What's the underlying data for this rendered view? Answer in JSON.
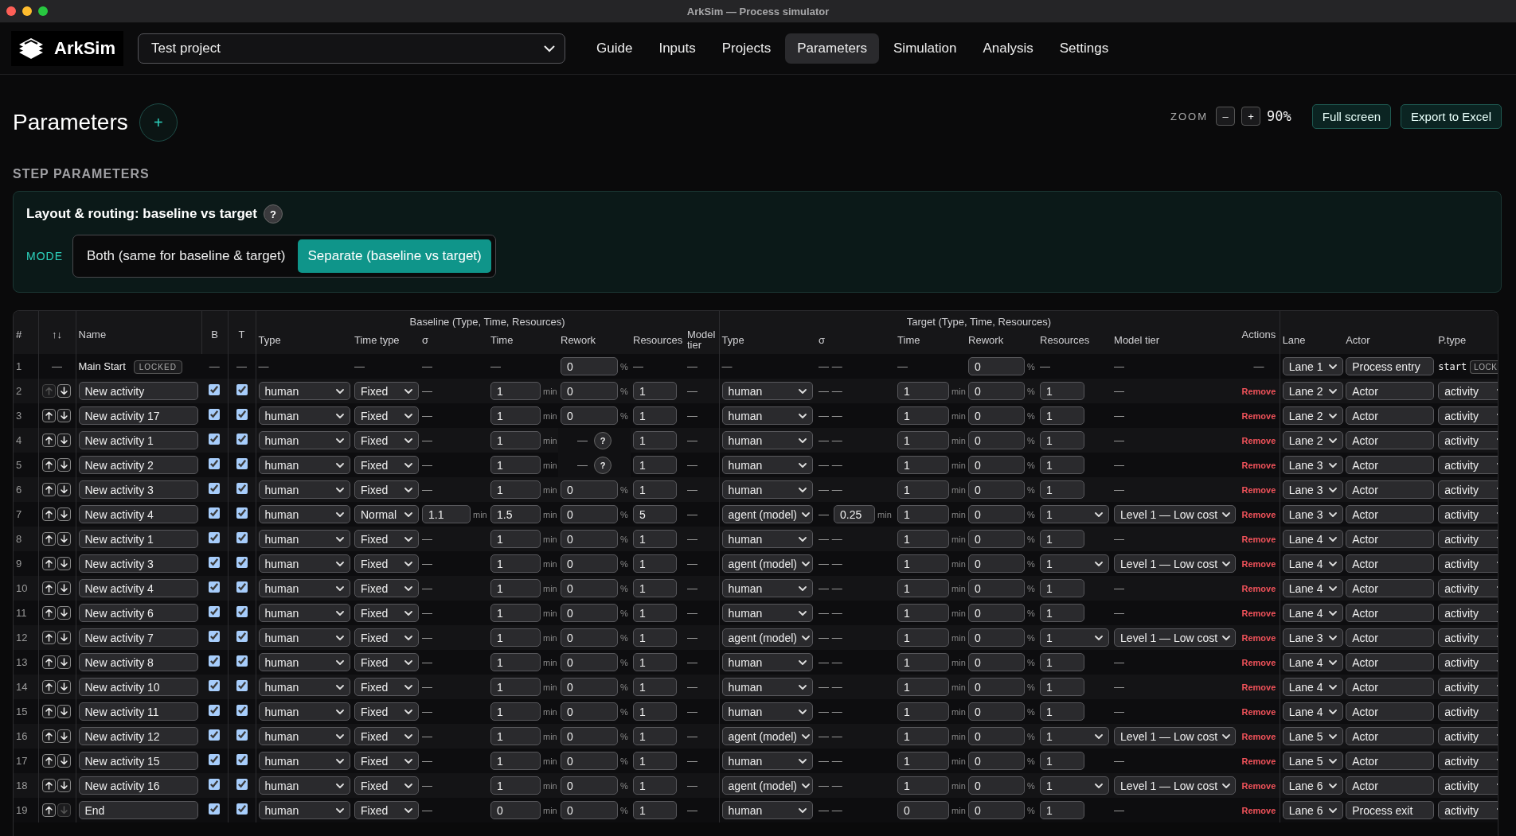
{
  "window": {
    "title": "ArkSim — Process simulator"
  },
  "header": {
    "brand": "ArkSim",
    "project": "Test project",
    "nav": [
      {
        "label": "Guide",
        "selected": false
      },
      {
        "label": "Inputs",
        "selected": false
      },
      {
        "label": "Projects",
        "selected": false
      },
      {
        "label": "Parameters",
        "selected": true
      },
      {
        "label": "Simulation",
        "selected": false
      },
      {
        "label": "Analysis",
        "selected": false
      },
      {
        "label": "Settings",
        "selected": false
      }
    ]
  },
  "page": {
    "title": "Parameters",
    "add": "+",
    "zoom_label": "ZOOM",
    "zoom_out": "–",
    "zoom_in": "+",
    "zoom_value": "90%",
    "buttons": [
      "Full screen",
      "Export to Excel"
    ]
  },
  "section": "STEP PARAMETERS",
  "card": {
    "title": "Layout & routing: baseline vs target",
    "help": "?",
    "mode_label": "MODE",
    "options": [
      {
        "label": "Both (same for baseline & target)",
        "selected": false
      },
      {
        "label": "Separate (baseline vs target)",
        "selected": true
      }
    ]
  },
  "table": {
    "columns_left": [
      "#",
      "↑↓",
      "Name",
      "B",
      "T"
    ],
    "baseline": {
      "title": "Baseline (Type, Time, Resources)",
      "columns": [
        "Type",
        "Time type",
        "σ",
        "Time",
        "Rework",
        "Resources",
        "Model tier"
      ]
    },
    "target": {
      "title": "Target (Type, Time, Resources)",
      "columns": [
        "Type",
        "σ",
        "Time",
        "Rework",
        "Resources",
        "Model tier"
      ]
    },
    "actions": "Actions",
    "columns_right": [
      "Lane",
      "Actor",
      "P.type"
    ],
    "rows": [
      {
        "n": "1",
        "cells": [
          {
            "kind": "text",
            "text": "—"
          },
          {
            "kind": "text",
            "text": "Main Start",
            "badge": "LOCKED"
          },
          {
            "kind": "text",
            "text": "—"
          },
          {
            "kind": "text",
            "text": "—"
          },
          {
            "kind": "text",
            "text": "—"
          },
          {
            "kind": "text",
            "text": "—"
          },
          {
            "kind": "text",
            "text": "—"
          },
          {
            "kind": "text",
            "text": "—"
          },
          {
            "kind": "input",
            "value": "0",
            "unit": "%"
          },
          {
            "kind": "text",
            "text": "—"
          },
          {
            "kind": "text",
            "text": "—"
          },
          {
            "kind": "text",
            "text": "—"
          },
          {
            "kind": "text",
            "text": "— —"
          },
          {
            "kind": "text",
            "text": "—"
          },
          {
            "kind": "input",
            "value": "0",
            "unit": "%"
          },
          {
            "kind": "text",
            "text": "—"
          },
          {
            "kind": "text",
            "text": "—"
          },
          {
            "kind": "text",
            "text": "—"
          },
          {
            "kind": "select",
            "value": "Lane 1"
          },
          {
            "kind": "input",
            "value": "Process entry"
          },
          {
            "kind": "code",
            "text": "start",
            "badge": "LOCK"
          }
        ]
      },
      {
        "n": "2",
        "cells": [
          {
            "kind": "move",
            "up_disabled": true,
            "down_disabled": false
          },
          {
            "kind": "input",
            "value": "New activity"
          },
          {
            "kind": "check",
            "checked": true
          },
          {
            "kind": "check",
            "checked": true
          },
          {
            "kind": "select",
            "value": "human"
          },
          {
            "kind": "select",
            "value": "Fixed"
          },
          {
            "kind": "text",
            "text": "—"
          },
          {
            "kind": "input",
            "value": "1",
            "unit": "min"
          },
          {
            "kind": "input",
            "value": "0",
            "unit": "%"
          },
          {
            "kind": "input",
            "value": "1"
          },
          {
            "kind": "text",
            "text": "—"
          },
          {
            "kind": "select",
            "value": "human"
          },
          {
            "kind": "text",
            "text": "— —"
          },
          {
            "kind": "input",
            "value": "1",
            "unit": "min"
          },
          {
            "kind": "input",
            "value": "0",
            "unit": "%"
          },
          {
            "kind": "input",
            "value": "1"
          },
          {
            "kind": "text",
            "text": "—"
          },
          {
            "kind": "link",
            "text": "Remove"
          },
          {
            "kind": "select",
            "value": "Lane 2"
          },
          {
            "kind": "input",
            "value": "Actor"
          },
          {
            "kind": "select",
            "value": "activity"
          }
        ]
      },
      {
        "n": "3",
        "cells": [
          {
            "kind": "move",
            "up_disabled": false,
            "down_disabled": false
          },
          {
            "kind": "input",
            "value": "New activity 17"
          },
          {
            "kind": "check",
            "checked": true
          },
          {
            "kind": "check",
            "checked": true
          },
          {
            "kind": "select",
            "value": "human"
          },
          {
            "kind": "select",
            "value": "Fixed"
          },
          {
            "kind": "text",
            "text": "—"
          },
          {
            "kind": "input",
            "value": "1",
            "unit": "min"
          },
          {
            "kind": "input",
            "value": "0",
            "unit": "%"
          },
          {
            "kind": "input",
            "value": "1"
          },
          {
            "kind": "text",
            "text": "—"
          },
          {
            "kind": "select",
            "value": "human"
          },
          {
            "kind": "text",
            "text": "— —"
          },
          {
            "kind": "input",
            "value": "1",
            "unit": "min"
          },
          {
            "kind": "input",
            "value": "0",
            "unit": "%"
          },
          {
            "kind": "input",
            "value": "1"
          },
          {
            "kind": "text",
            "text": "—"
          },
          {
            "kind": "link",
            "text": "Remove"
          },
          {
            "kind": "select",
            "value": "Lane 2"
          },
          {
            "kind": "input",
            "value": "Actor"
          },
          {
            "kind": "select",
            "value": "activity"
          }
        ]
      },
      {
        "n": "4",
        "cells": [
          {
            "kind": "move",
            "up_disabled": false,
            "down_disabled": false
          },
          {
            "kind": "input",
            "value": "New activity 1"
          },
          {
            "kind": "check",
            "checked": true
          },
          {
            "kind": "check",
            "checked": true
          },
          {
            "kind": "select",
            "value": "human"
          },
          {
            "kind": "select",
            "value": "Fixed"
          },
          {
            "kind": "text",
            "text": "—"
          },
          {
            "kind": "input",
            "value": "1",
            "unit": "min"
          },
          {
            "kind": "text",
            "text": "—",
            "help": "?"
          },
          {
            "kind": "input",
            "value": "1"
          },
          {
            "kind": "text",
            "text": "—"
          },
          {
            "kind": "select",
            "value": "human"
          },
          {
            "kind": "text",
            "text": "— —"
          },
          {
            "kind": "input",
            "value": "1",
            "unit": "min"
          },
          {
            "kind": "input",
            "value": "0",
            "unit": "%"
          },
          {
            "kind": "input",
            "value": "1"
          },
          {
            "kind": "text",
            "text": "—"
          },
          {
            "kind": "link",
            "text": "Remove"
          },
          {
            "kind": "select",
            "value": "Lane 2"
          },
          {
            "kind": "input",
            "value": "Actor"
          },
          {
            "kind": "select",
            "value": "activity"
          }
        ]
      },
      {
        "n": "5",
        "cells": [
          {
            "kind": "move",
            "up_disabled": false,
            "down_disabled": false
          },
          {
            "kind": "input",
            "value": "New activity 2"
          },
          {
            "kind": "check",
            "checked": true
          },
          {
            "kind": "check",
            "checked": true
          },
          {
            "kind": "select",
            "value": "human"
          },
          {
            "kind": "select",
            "value": "Fixed"
          },
          {
            "kind": "text",
            "text": "—"
          },
          {
            "kind": "input",
            "value": "1",
            "unit": "min"
          },
          {
            "kind": "text",
            "text": "—",
            "help": "?"
          },
          {
            "kind": "input",
            "value": "1"
          },
          {
            "kind": "text",
            "text": "—"
          },
          {
            "kind": "select",
            "value": "human"
          },
          {
            "kind": "text",
            "text": "— —"
          },
          {
            "kind": "input",
            "value": "1",
            "unit": "min"
          },
          {
            "kind": "input",
            "value": "0",
            "unit": "%"
          },
          {
            "kind": "input",
            "value": "1"
          },
          {
            "kind": "text",
            "text": "—"
          },
          {
            "kind": "link",
            "text": "Remove"
          },
          {
            "kind": "select",
            "value": "Lane 3"
          },
          {
            "kind": "input",
            "value": "Actor"
          },
          {
            "kind": "select",
            "value": "activity"
          }
        ]
      },
      {
        "n": "6",
        "cells": [
          {
            "kind": "move",
            "up_disabled": false,
            "down_disabled": false
          },
          {
            "kind": "input",
            "value": "New activity 3"
          },
          {
            "kind": "check",
            "checked": true
          },
          {
            "kind": "check",
            "checked": true
          },
          {
            "kind": "select",
            "value": "human"
          },
          {
            "kind": "select",
            "value": "Fixed"
          },
          {
            "kind": "text",
            "text": "—"
          },
          {
            "kind": "input",
            "value": "1",
            "unit": "min"
          },
          {
            "kind": "input",
            "value": "0",
            "unit": "%"
          },
          {
            "kind": "input",
            "value": "1"
          },
          {
            "kind": "text",
            "text": "—"
          },
          {
            "kind": "select",
            "value": "human"
          },
          {
            "kind": "text",
            "text": "— —"
          },
          {
            "kind": "input",
            "value": "1",
            "unit": "min"
          },
          {
            "kind": "input",
            "value": "0",
            "unit": "%"
          },
          {
            "kind": "input",
            "value": "1"
          },
          {
            "kind": "text",
            "text": "—"
          },
          {
            "kind": "link",
            "text": "Remove"
          },
          {
            "kind": "select",
            "value": "Lane 3"
          },
          {
            "kind": "input",
            "value": "Actor"
          },
          {
            "kind": "select",
            "value": "activity"
          }
        ]
      },
      {
        "n": "7",
        "cells": [
          {
            "kind": "move",
            "up_disabled": false,
            "down_disabled": false
          },
          {
            "kind": "input",
            "value": "New activity 4"
          },
          {
            "kind": "check",
            "checked": true
          },
          {
            "kind": "check",
            "checked": true
          },
          {
            "kind": "select",
            "value": "human"
          },
          {
            "kind": "select",
            "value": "Normal"
          },
          {
            "kind": "input",
            "value": "1.1",
            "unit": "min"
          },
          {
            "kind": "input",
            "value": "1.5",
            "unit": "min"
          },
          {
            "kind": "input",
            "value": "0",
            "unit": "%"
          },
          {
            "kind": "input",
            "value": "5"
          },
          {
            "kind": "text",
            "text": "—"
          },
          {
            "kind": "select",
            "value": "agent (model)"
          },
          {
            "kind": "input",
            "prefix": "—",
            "value": "0.25",
            "unit": "min"
          },
          {
            "kind": "input",
            "value": "1",
            "unit": "min"
          },
          {
            "kind": "input",
            "value": "0",
            "unit": "%"
          },
          {
            "kind": "select",
            "value": "1"
          },
          {
            "kind": "select",
            "value": "Level 1 — Low cost"
          },
          {
            "kind": "link",
            "text": "Remove"
          },
          {
            "kind": "select",
            "value": "Lane 3"
          },
          {
            "kind": "input",
            "value": "Actor"
          },
          {
            "kind": "select",
            "value": "activity"
          }
        ]
      },
      {
        "n": "8",
        "cells": [
          {
            "kind": "move",
            "up_disabled": false,
            "down_disabled": false
          },
          {
            "kind": "input",
            "value": "New activity 1"
          },
          {
            "kind": "check",
            "checked": true
          },
          {
            "kind": "check",
            "checked": true
          },
          {
            "kind": "select",
            "value": "human"
          },
          {
            "kind": "select",
            "value": "Fixed"
          },
          {
            "kind": "text",
            "text": "—"
          },
          {
            "kind": "input",
            "value": "1",
            "unit": "min"
          },
          {
            "kind": "input",
            "value": "0",
            "unit": "%"
          },
          {
            "kind": "input",
            "value": "1"
          },
          {
            "kind": "text",
            "text": "—"
          },
          {
            "kind": "select",
            "value": "human"
          },
          {
            "kind": "text",
            "text": "— —"
          },
          {
            "kind": "input",
            "value": "1",
            "unit": "min"
          },
          {
            "kind": "input",
            "value": "0",
            "unit": "%"
          },
          {
            "kind": "input",
            "value": "1"
          },
          {
            "kind": "text",
            "text": "—"
          },
          {
            "kind": "link",
            "text": "Remove"
          },
          {
            "kind": "select",
            "value": "Lane 4"
          },
          {
            "kind": "input",
            "value": "Actor"
          },
          {
            "kind": "select",
            "value": "activity"
          }
        ]
      },
      {
        "n": "9",
        "cells": [
          {
            "kind": "move",
            "up_disabled": false,
            "down_disabled": false
          },
          {
            "kind": "input",
            "value": "New activity 3"
          },
          {
            "kind": "check",
            "checked": true
          },
          {
            "kind": "check",
            "checked": true
          },
          {
            "kind": "select",
            "value": "human"
          },
          {
            "kind": "select",
            "value": "Fixed"
          },
          {
            "kind": "text",
            "text": "—"
          },
          {
            "kind": "input",
            "value": "1",
            "unit": "min"
          },
          {
            "kind": "input",
            "value": "0",
            "unit": "%"
          },
          {
            "kind": "input",
            "value": "1"
          },
          {
            "kind": "text",
            "text": "—"
          },
          {
            "kind": "select",
            "value": "agent (model)"
          },
          {
            "kind": "text",
            "text": "— —"
          },
          {
            "kind": "input",
            "value": "1",
            "unit": "min"
          },
          {
            "kind": "input",
            "value": "0",
            "unit": "%"
          },
          {
            "kind": "select",
            "value": "1"
          },
          {
            "kind": "select",
            "value": "Level 1 — Low cost"
          },
          {
            "kind": "link",
            "text": "Remove"
          },
          {
            "kind": "select",
            "value": "Lane 4"
          },
          {
            "kind": "input",
            "value": "Actor"
          },
          {
            "kind": "select",
            "value": "activity"
          }
        ]
      },
      {
        "n": "10",
        "cells": [
          {
            "kind": "move",
            "up_disabled": false,
            "down_disabled": false
          },
          {
            "kind": "input",
            "value": "New activity 4"
          },
          {
            "kind": "check",
            "checked": true
          },
          {
            "kind": "check",
            "checked": true
          },
          {
            "kind": "select",
            "value": "human"
          },
          {
            "kind": "select",
            "value": "Fixed"
          },
          {
            "kind": "text",
            "text": "—"
          },
          {
            "kind": "input",
            "value": "1",
            "unit": "min"
          },
          {
            "kind": "input",
            "value": "0",
            "unit": "%"
          },
          {
            "kind": "input",
            "value": "1"
          },
          {
            "kind": "text",
            "text": "—"
          },
          {
            "kind": "select",
            "value": "human"
          },
          {
            "kind": "text",
            "text": "— —"
          },
          {
            "kind": "input",
            "value": "1",
            "unit": "min"
          },
          {
            "kind": "input",
            "value": "0",
            "unit": "%"
          },
          {
            "kind": "input",
            "value": "1"
          },
          {
            "kind": "text",
            "text": "—"
          },
          {
            "kind": "link",
            "text": "Remove"
          },
          {
            "kind": "select",
            "value": "Lane 4"
          },
          {
            "kind": "input",
            "value": "Actor"
          },
          {
            "kind": "select",
            "value": "activity"
          }
        ]
      },
      {
        "n": "11",
        "cells": [
          {
            "kind": "move",
            "up_disabled": false,
            "down_disabled": false
          },
          {
            "kind": "input",
            "value": "New activity 6"
          },
          {
            "kind": "check",
            "checked": true
          },
          {
            "kind": "check",
            "checked": true
          },
          {
            "kind": "select",
            "value": "human"
          },
          {
            "kind": "select",
            "value": "Fixed"
          },
          {
            "kind": "text",
            "text": "—"
          },
          {
            "kind": "input",
            "value": "1",
            "unit": "min"
          },
          {
            "kind": "input",
            "value": "0",
            "unit": "%"
          },
          {
            "kind": "input",
            "value": "1"
          },
          {
            "kind": "text",
            "text": "—"
          },
          {
            "kind": "select",
            "value": "human"
          },
          {
            "kind": "text",
            "text": "— —"
          },
          {
            "kind": "input",
            "value": "1",
            "unit": "min"
          },
          {
            "kind": "input",
            "value": "0",
            "unit": "%"
          },
          {
            "kind": "input",
            "value": "1"
          },
          {
            "kind": "text",
            "text": "—"
          },
          {
            "kind": "link",
            "text": "Remove"
          },
          {
            "kind": "select",
            "value": "Lane 4"
          },
          {
            "kind": "input",
            "value": "Actor"
          },
          {
            "kind": "select",
            "value": "activity"
          }
        ]
      },
      {
        "n": "12",
        "cells": [
          {
            "kind": "move",
            "up_disabled": false,
            "down_disabled": false
          },
          {
            "kind": "input",
            "value": "New activity 7"
          },
          {
            "kind": "check",
            "checked": true
          },
          {
            "kind": "check",
            "checked": true
          },
          {
            "kind": "select",
            "value": "human"
          },
          {
            "kind": "select",
            "value": "Fixed"
          },
          {
            "kind": "text",
            "text": "—"
          },
          {
            "kind": "input",
            "value": "1",
            "unit": "min"
          },
          {
            "kind": "input",
            "value": "0",
            "unit": "%"
          },
          {
            "kind": "input",
            "value": "1"
          },
          {
            "kind": "text",
            "text": "—"
          },
          {
            "kind": "select",
            "value": "agent (model)"
          },
          {
            "kind": "text",
            "text": "— —"
          },
          {
            "kind": "input",
            "value": "1",
            "unit": "min"
          },
          {
            "kind": "input",
            "value": "0",
            "unit": "%"
          },
          {
            "kind": "select",
            "value": "1"
          },
          {
            "kind": "select",
            "value": "Level 1 — Low cost"
          },
          {
            "kind": "link",
            "text": "Remove"
          },
          {
            "kind": "select",
            "value": "Lane 3"
          },
          {
            "kind": "input",
            "value": "Actor"
          },
          {
            "kind": "select",
            "value": "activity"
          }
        ]
      },
      {
        "n": "13",
        "cells": [
          {
            "kind": "move",
            "up_disabled": false,
            "down_disabled": false
          },
          {
            "kind": "input",
            "value": "New activity 8"
          },
          {
            "kind": "check",
            "checked": true
          },
          {
            "kind": "check",
            "checked": true
          },
          {
            "kind": "select",
            "value": "human"
          },
          {
            "kind": "select",
            "value": "Fixed"
          },
          {
            "kind": "text",
            "text": "—"
          },
          {
            "kind": "input",
            "value": "1",
            "unit": "min"
          },
          {
            "kind": "input",
            "value": "0",
            "unit": "%"
          },
          {
            "kind": "input",
            "value": "1"
          },
          {
            "kind": "text",
            "text": "—"
          },
          {
            "kind": "select",
            "value": "human"
          },
          {
            "kind": "text",
            "text": "— —"
          },
          {
            "kind": "input",
            "value": "1",
            "unit": "min"
          },
          {
            "kind": "input",
            "value": "0",
            "unit": "%"
          },
          {
            "kind": "input",
            "value": "1"
          },
          {
            "kind": "text",
            "text": "—"
          },
          {
            "kind": "link",
            "text": "Remove"
          },
          {
            "kind": "select",
            "value": "Lane 4"
          },
          {
            "kind": "input",
            "value": "Actor"
          },
          {
            "kind": "select",
            "value": "activity"
          }
        ]
      },
      {
        "n": "14",
        "cells": [
          {
            "kind": "move",
            "up_disabled": false,
            "down_disabled": false
          },
          {
            "kind": "input",
            "value": "New activity 10"
          },
          {
            "kind": "check",
            "checked": true
          },
          {
            "kind": "check",
            "checked": true
          },
          {
            "kind": "select",
            "value": "human"
          },
          {
            "kind": "select",
            "value": "Fixed"
          },
          {
            "kind": "text",
            "text": "—"
          },
          {
            "kind": "input",
            "value": "1",
            "unit": "min"
          },
          {
            "kind": "input",
            "value": "0",
            "unit": "%"
          },
          {
            "kind": "input",
            "value": "1"
          },
          {
            "kind": "text",
            "text": "—"
          },
          {
            "kind": "select",
            "value": "human"
          },
          {
            "kind": "text",
            "text": "— —"
          },
          {
            "kind": "input",
            "value": "1",
            "unit": "min"
          },
          {
            "kind": "input",
            "value": "0",
            "unit": "%"
          },
          {
            "kind": "input",
            "value": "1"
          },
          {
            "kind": "text",
            "text": "—"
          },
          {
            "kind": "link",
            "text": "Remove"
          },
          {
            "kind": "select",
            "value": "Lane 4"
          },
          {
            "kind": "input",
            "value": "Actor"
          },
          {
            "kind": "select",
            "value": "activity"
          }
        ]
      },
      {
        "n": "15",
        "cells": [
          {
            "kind": "move",
            "up_disabled": false,
            "down_disabled": false
          },
          {
            "kind": "input",
            "value": "New activity 11"
          },
          {
            "kind": "check",
            "checked": true
          },
          {
            "kind": "check",
            "checked": true
          },
          {
            "kind": "select",
            "value": "human"
          },
          {
            "kind": "select",
            "value": "Fixed"
          },
          {
            "kind": "text",
            "text": "—"
          },
          {
            "kind": "input",
            "value": "1",
            "unit": "min"
          },
          {
            "kind": "input",
            "value": "0",
            "unit": "%"
          },
          {
            "kind": "input",
            "value": "1"
          },
          {
            "kind": "text",
            "text": "—"
          },
          {
            "kind": "select",
            "value": "human"
          },
          {
            "kind": "text",
            "text": "— —"
          },
          {
            "kind": "input",
            "value": "1",
            "unit": "min"
          },
          {
            "kind": "input",
            "value": "0",
            "unit": "%"
          },
          {
            "kind": "input",
            "value": "1"
          },
          {
            "kind": "text",
            "text": "—"
          },
          {
            "kind": "link",
            "text": "Remove"
          },
          {
            "kind": "select",
            "value": "Lane 4"
          },
          {
            "kind": "input",
            "value": "Actor"
          },
          {
            "kind": "select",
            "value": "activity"
          }
        ]
      },
      {
        "n": "16",
        "cells": [
          {
            "kind": "move",
            "up_disabled": false,
            "down_disabled": false
          },
          {
            "kind": "input",
            "value": "New activity 12"
          },
          {
            "kind": "check",
            "checked": true
          },
          {
            "kind": "check",
            "checked": true
          },
          {
            "kind": "select",
            "value": "human"
          },
          {
            "kind": "select",
            "value": "Fixed"
          },
          {
            "kind": "text",
            "text": "—"
          },
          {
            "kind": "input",
            "value": "1",
            "unit": "min"
          },
          {
            "kind": "input",
            "value": "0",
            "unit": "%"
          },
          {
            "kind": "input",
            "value": "1"
          },
          {
            "kind": "text",
            "text": "—"
          },
          {
            "kind": "select",
            "value": "agent (model)"
          },
          {
            "kind": "text",
            "text": "— —"
          },
          {
            "kind": "input",
            "value": "1",
            "unit": "min"
          },
          {
            "kind": "input",
            "value": "0",
            "unit": "%"
          },
          {
            "kind": "select",
            "value": "1"
          },
          {
            "kind": "select",
            "value": "Level 1 — Low cost"
          },
          {
            "kind": "link",
            "text": "Remove"
          },
          {
            "kind": "select",
            "value": "Lane 5"
          },
          {
            "kind": "input",
            "value": "Actor"
          },
          {
            "kind": "select",
            "value": "activity"
          }
        ]
      },
      {
        "n": "17",
        "cells": [
          {
            "kind": "move",
            "up_disabled": false,
            "down_disabled": false
          },
          {
            "kind": "input",
            "value": "New activity 15"
          },
          {
            "kind": "check",
            "checked": true
          },
          {
            "kind": "check",
            "checked": true
          },
          {
            "kind": "select",
            "value": "human"
          },
          {
            "kind": "select",
            "value": "Fixed"
          },
          {
            "kind": "text",
            "text": "—"
          },
          {
            "kind": "input",
            "value": "1",
            "unit": "min"
          },
          {
            "kind": "input",
            "value": "0",
            "unit": "%"
          },
          {
            "kind": "input",
            "value": "1"
          },
          {
            "kind": "text",
            "text": "—"
          },
          {
            "kind": "select",
            "value": "human"
          },
          {
            "kind": "text",
            "text": "— —"
          },
          {
            "kind": "input",
            "value": "1",
            "unit": "min"
          },
          {
            "kind": "input",
            "value": "0",
            "unit": "%"
          },
          {
            "kind": "input",
            "value": "1"
          },
          {
            "kind": "text",
            "text": "—"
          },
          {
            "kind": "link",
            "text": "Remove"
          },
          {
            "kind": "select",
            "value": "Lane 5"
          },
          {
            "kind": "input",
            "value": "Actor"
          },
          {
            "kind": "select",
            "value": "activity"
          }
        ]
      },
      {
        "n": "18",
        "cells": [
          {
            "kind": "move",
            "up_disabled": false,
            "down_disabled": false
          },
          {
            "kind": "input",
            "value": "New activity 16"
          },
          {
            "kind": "check",
            "checked": true
          },
          {
            "kind": "check",
            "checked": true
          },
          {
            "kind": "select",
            "value": "human"
          },
          {
            "kind": "select",
            "value": "Fixed"
          },
          {
            "kind": "text",
            "text": "—"
          },
          {
            "kind": "input",
            "value": "1",
            "unit": "min"
          },
          {
            "kind": "input",
            "value": "0",
            "unit": "%"
          },
          {
            "kind": "input",
            "value": "1"
          },
          {
            "kind": "text",
            "text": "—"
          },
          {
            "kind": "select",
            "value": "agent (model)"
          },
          {
            "kind": "text",
            "text": "— —"
          },
          {
            "kind": "input",
            "value": "1",
            "unit": "min"
          },
          {
            "kind": "input",
            "value": "0",
            "unit": "%"
          },
          {
            "kind": "select",
            "value": "1"
          },
          {
            "kind": "select",
            "value": "Level 1 — Low cost"
          },
          {
            "kind": "link",
            "text": "Remove"
          },
          {
            "kind": "select",
            "value": "Lane 6"
          },
          {
            "kind": "input",
            "value": "Actor"
          },
          {
            "kind": "select",
            "value": "activity"
          }
        ]
      },
      {
        "n": "19",
        "cells": [
          {
            "kind": "move",
            "up_disabled": false,
            "down_disabled": true
          },
          {
            "kind": "input",
            "value": "End"
          },
          {
            "kind": "check",
            "checked": true
          },
          {
            "kind": "check",
            "checked": true
          },
          {
            "kind": "select",
            "value": "human"
          },
          {
            "kind": "select",
            "value": "Fixed"
          },
          {
            "kind": "text",
            "text": "—"
          },
          {
            "kind": "input",
            "value": "0",
            "unit": "min"
          },
          {
            "kind": "input",
            "value": "0",
            "unit": "%"
          },
          {
            "kind": "input",
            "value": "1"
          },
          {
            "kind": "text",
            "text": "—"
          },
          {
            "kind": "select",
            "value": "human"
          },
          {
            "kind": "text",
            "text": "— —"
          },
          {
            "kind": "input",
            "value": "0",
            "unit": "min"
          },
          {
            "kind": "input",
            "value": "0",
            "unit": "%"
          },
          {
            "kind": "input",
            "value": "1"
          },
          {
            "kind": "text",
            "text": "—"
          },
          {
            "kind": "link",
            "text": "Remove"
          },
          {
            "kind": "select",
            "value": "Lane 6"
          },
          {
            "kind": "input",
            "value": "Process exit"
          },
          {
            "kind": "select",
            "value": "activity"
          }
        ]
      }
    ]
  }
}
